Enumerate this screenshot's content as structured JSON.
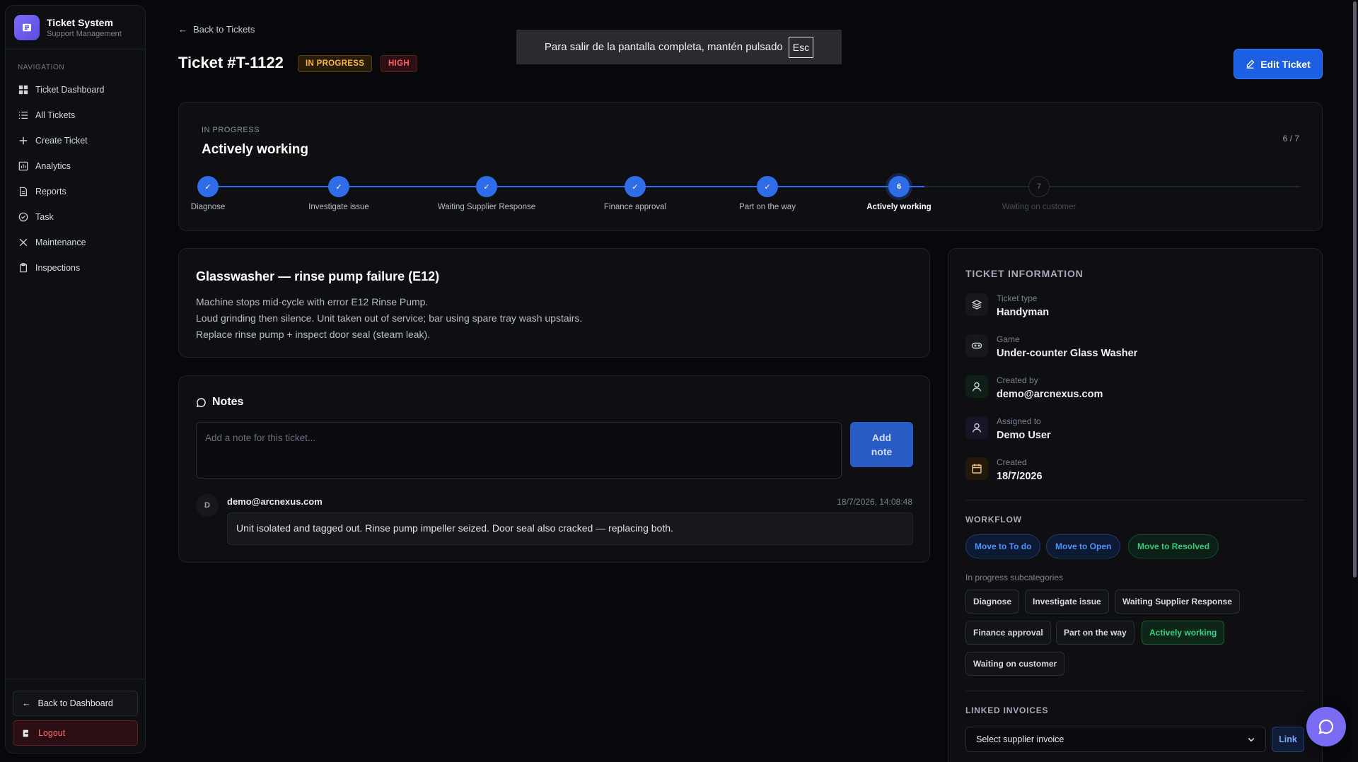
{
  "brand": {
    "title": "Ticket System",
    "subtitle": "Support Management"
  },
  "nav": {
    "label": "NAVIGATION",
    "items": [
      {
        "label": "Ticket Dashboard",
        "icon": "grid-icon"
      },
      {
        "label": "All Tickets",
        "icon": "list-icon"
      },
      {
        "label": "Create Ticket",
        "icon": "plus-icon"
      },
      {
        "label": "Analytics",
        "icon": "chart-icon"
      },
      {
        "label": "Reports",
        "icon": "report-icon"
      },
      {
        "label": "Task",
        "icon": "check-circle-icon"
      },
      {
        "label": "Maintenance",
        "icon": "wrench-icon"
      },
      {
        "label": "Inspections",
        "icon": "clipboard-icon"
      }
    ],
    "back": "Back to Dashboard",
    "logout": "Logout"
  },
  "header": {
    "back_link": "Back to Tickets",
    "title": "Ticket #T-1122",
    "status_badge": "IN PROGRESS",
    "priority_badge": "HIGH",
    "edit_button": "Edit Ticket"
  },
  "toast": {
    "text": "Para salir de la pantalla completa, mantén pulsado",
    "key": "Esc"
  },
  "progress": {
    "kicker": "IN PROGRESS",
    "title": "Actively working",
    "count": "6 / 7",
    "current_step": 6,
    "total_steps": 7,
    "steps": [
      {
        "label": "Diagnose",
        "state": "done",
        "marker": "✓"
      },
      {
        "label": "Investigate issue",
        "state": "done",
        "marker": "✓"
      },
      {
        "label": "Waiting Supplier Response",
        "state": "done",
        "marker": "✓"
      },
      {
        "label": "Finance approval",
        "state": "done",
        "marker": "✓"
      },
      {
        "label": "Part on the way",
        "state": "done",
        "marker": "✓"
      },
      {
        "label": "Actively working",
        "state": "current",
        "marker": "6"
      },
      {
        "label": "Waiting on customer",
        "state": "future",
        "marker": "7"
      }
    ]
  },
  "description": {
    "title": "Glasswasher — rinse pump failure (E12)",
    "lines": [
      "Machine stops mid-cycle with error E12 Rinse Pump.",
      "Loud grinding then silence. Unit taken out of service; bar using spare tray wash upstairs.",
      "Replace rinse pump + inspect door seal (steam leak)."
    ]
  },
  "notes": {
    "title": "Notes",
    "input_placeholder": "Add a note for this ticket...",
    "add_button_line1": "Add",
    "add_button_line2": "note",
    "items": [
      {
        "avatar": "D",
        "author": "demo@arcnexus.com",
        "time": "18/7/2026, 14:08:48",
        "text": "Unit isolated and tagged out. Rinse pump impeller seized. Door seal also cracked — replacing both."
      }
    ]
  },
  "info": {
    "title": "TICKET INFORMATION",
    "rows": [
      {
        "label": "Ticket type",
        "value": "Handyman",
        "icon": "layers-icon"
      },
      {
        "label": "Game",
        "value": "Under-counter Glass Washer",
        "icon": "gamepad-icon"
      },
      {
        "label": "Created by",
        "value": "demo@arcnexus.com",
        "icon": "user-icon"
      },
      {
        "label": "Assigned to",
        "value": "Demo User",
        "icon": "user-icon"
      },
      {
        "label": "Created",
        "value": "18/7/2026",
        "icon": "calendar-icon"
      }
    ],
    "workflow_title": "WORKFLOW",
    "workflow": [
      "Move to To do",
      "Move to Open",
      "Move to Resolved"
    ],
    "subcategories_label": "In progress subcategories",
    "subcategories": [
      {
        "label": "Diagnose",
        "active": false
      },
      {
        "label": "Investigate issue",
        "active": false
      },
      {
        "label": "Waiting Supplier Response",
        "active": false
      },
      {
        "label": "Finance approval",
        "active": false
      },
      {
        "label": "Part on the way",
        "active": false
      },
      {
        "label": "Actively working",
        "active": true
      },
      {
        "label": "Waiting on customer",
        "active": false
      }
    ],
    "linked_title": "LINKED INVOICES",
    "select_value": "Select supplier invoice",
    "link_button": "Link"
  },
  "colors": {
    "accent": "#1d5fe3",
    "progress_badge": "#f7b23b",
    "high_badge": "#ff5d5d",
    "success": "#33c77a",
    "brand": "#7b6cf6"
  }
}
